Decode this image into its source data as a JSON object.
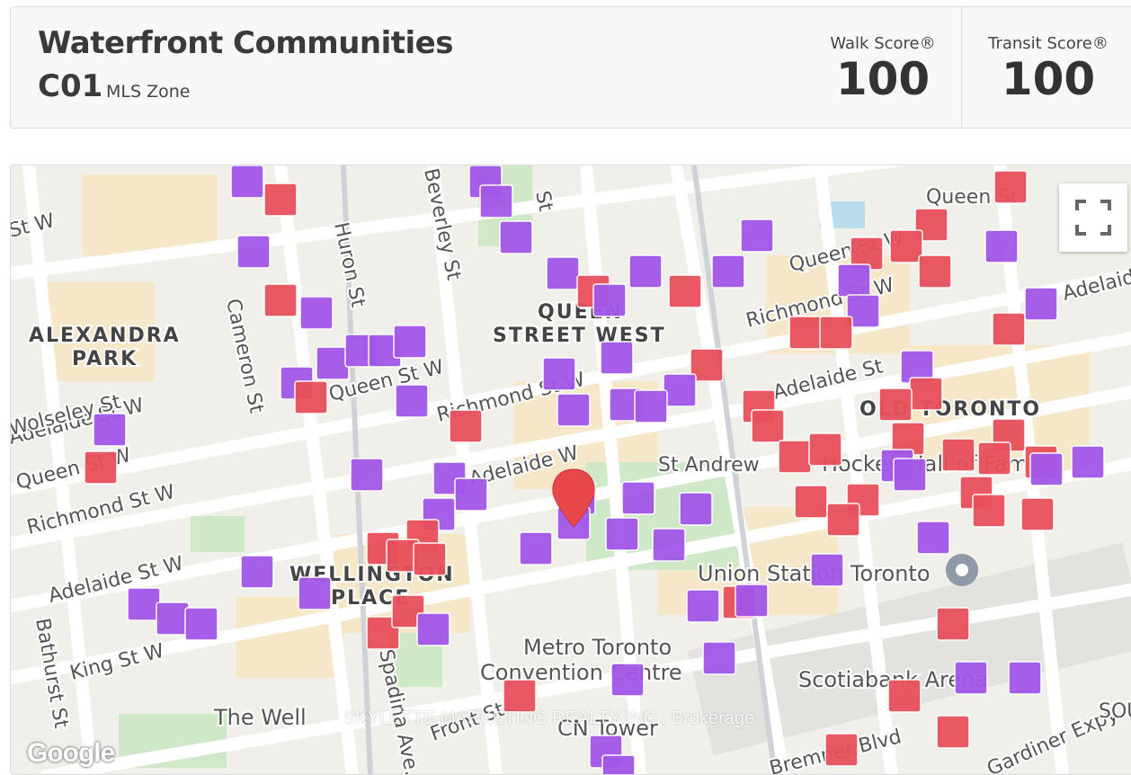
{
  "header": {
    "neighbourhood": "Waterfront Communities",
    "zone_code": "C01",
    "zone_label": "MLS Zone",
    "walk_score": {
      "label": "Walk Score®",
      "value": "100"
    },
    "transit_score": {
      "label": "Transit Score®",
      "value": "100"
    }
  },
  "map": {
    "attribution": "Google",
    "watermark": "SKYLETTE MARKETING REALTY INC., Brokerage",
    "districts": [
      "ALEXANDRA",
      "PARK",
      "QUEEN",
      "STREET WEST",
      "OLD TORONTO",
      "WELLINGTON",
      "PLACE"
    ],
    "streets": [
      "St W",
      "Beverley St",
      "Huron St",
      "Cameron St",
      "Queen St W",
      "Richmond St W",
      "Adelaide St W",
      "Wolseley St",
      "Adelaide W",
      "St Andrew",
      "King St W",
      "Bathurst St",
      "Spadina Ave.",
      "Front St",
      "Bremner Blvd",
      "Gardiner Expy",
      "Queen St",
      "Queen St W",
      "Richmond St W",
      "Adelaide St",
      "Adelaide",
      "St",
      "Queen St W",
      "Richmond St W",
      "Adelaide St W",
      "SOU"
    ],
    "pois": [
      "Union Station Toronto",
      "Metro Toronto",
      "Convention Centre",
      "Scotiabank Arena",
      "The Well",
      "CN Tower",
      "Hockey Hall of Fame"
    ],
    "colors": {
      "restaurant": "#a257e8",
      "shop": "#e8505b",
      "pin": "#e8474c",
      "park": "#cfe9c8",
      "water": "#b9dcee"
    }
  }
}
